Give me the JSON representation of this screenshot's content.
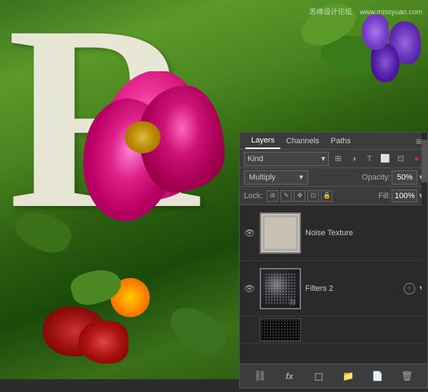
{
  "canvas": {
    "background_desc": "Floral arrangement with large letter R"
  },
  "watermark": {
    "text1": "思缘设计论坛",
    "text2": "www.missyuan.com"
  },
  "layers_panel": {
    "title": "Layers Panel",
    "tabs": [
      {
        "label": "Layers",
        "active": true
      },
      {
        "label": "Channels",
        "active": false
      },
      {
        "label": "Paths",
        "active": false
      }
    ],
    "search": {
      "kind_label": "Kind",
      "dropdown_arrow": "▾"
    },
    "blend_mode": {
      "label": "Multiply",
      "dropdown_arrow": "▾"
    },
    "opacity": {
      "label": "Opacity:",
      "value": "50%",
      "dropdown_arrow": "▾"
    },
    "lock": {
      "label": "Lock:",
      "icons": [
        "⊞",
        "✎",
        "✥",
        "⊡",
        "🔒"
      ]
    },
    "fill": {
      "label": "Fill:",
      "value": "100%",
      "dropdown_arrow": "▾"
    },
    "layers": [
      {
        "id": 1,
        "name": "Noise Texture",
        "visible": true,
        "thumb_type": "noise",
        "selected": false
      },
      {
        "id": 2,
        "name": "Filters 2",
        "visible": true,
        "thumb_type": "filter",
        "selected": false,
        "has_badge": true
      },
      {
        "id": 3,
        "name": "",
        "visible": false,
        "thumb_type": "small",
        "selected": false
      }
    ],
    "footer_buttons": [
      {
        "icon": "⊕",
        "name": "link-layers"
      },
      {
        "icon": "fx",
        "name": "add-layer-style"
      },
      {
        "icon": "◑",
        "name": "add-mask"
      },
      {
        "icon": "◈",
        "name": "new-group"
      },
      {
        "icon": "📄",
        "name": "new-layer"
      },
      {
        "icon": "🗑",
        "name": "delete-layer"
      }
    ]
  }
}
